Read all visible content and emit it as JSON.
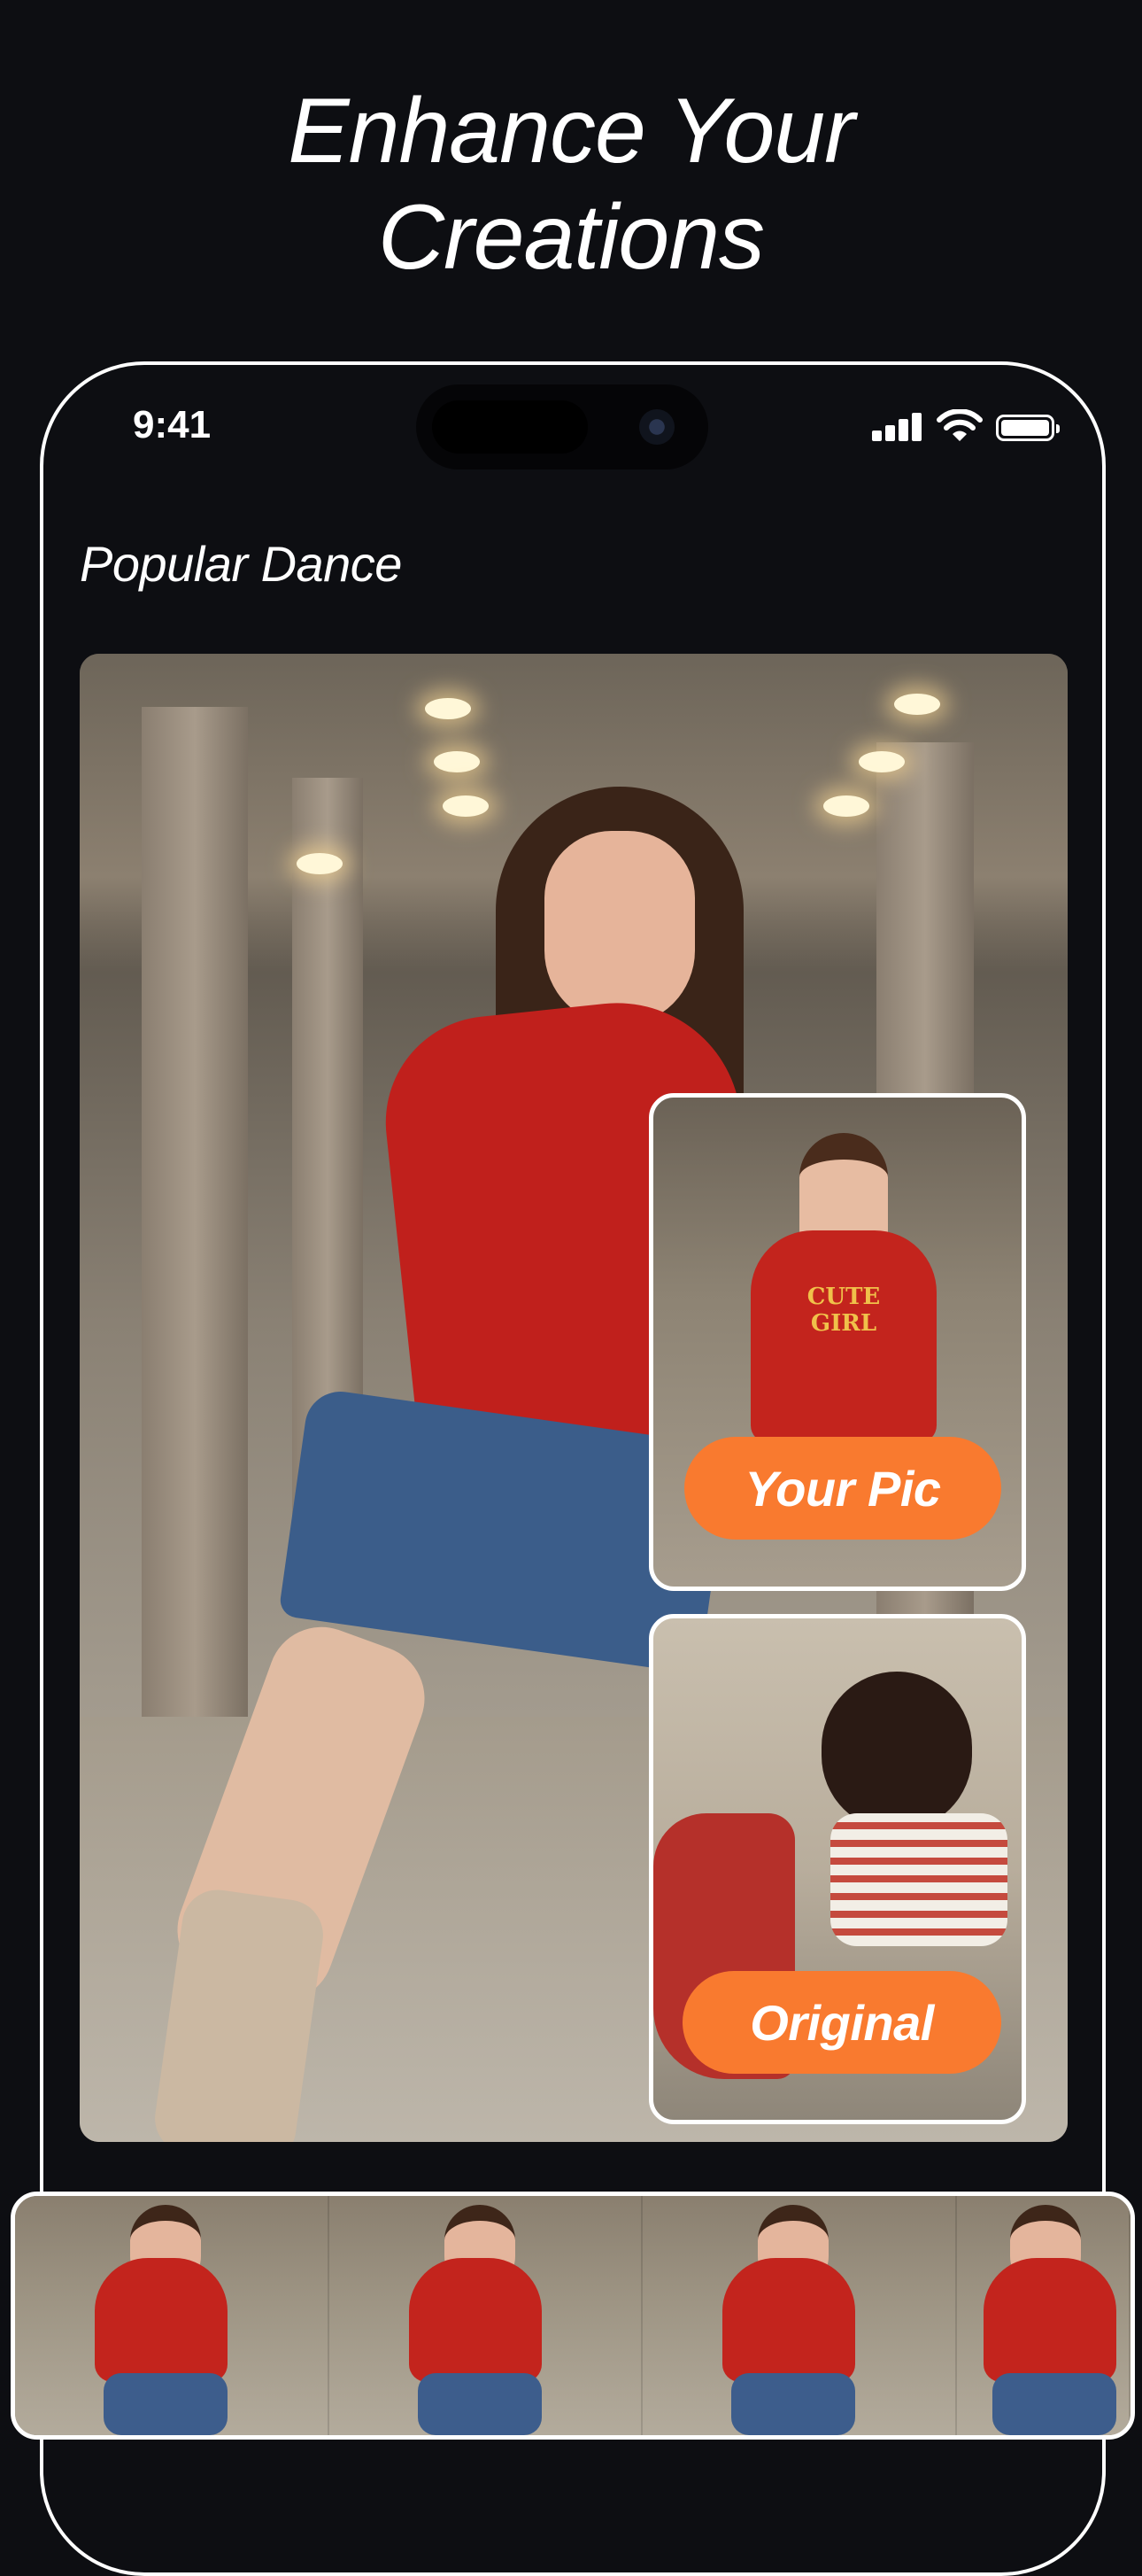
{
  "headline": {
    "line1": "Enhance Your",
    "line2": "Creations"
  },
  "status_bar": {
    "time": "9:41"
  },
  "section": {
    "title": "Popular Dance"
  },
  "overlays": {
    "your_pic": "Your Pic",
    "original": "Original"
  },
  "thumb_print": "CUTE GIRL",
  "filmstrip": {
    "frame_count": 4
  },
  "colors": {
    "background": "#0d0e12",
    "accent": "#f97a2f",
    "frame": "#ffffff"
  }
}
